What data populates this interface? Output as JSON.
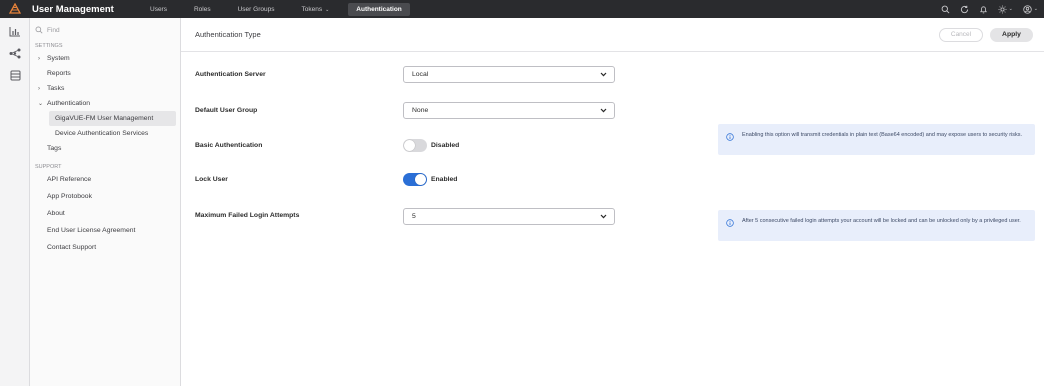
{
  "app": {
    "title": "User Management"
  },
  "nav": {
    "items": [
      {
        "label": "Users"
      },
      {
        "label": "Roles"
      },
      {
        "label": "User Groups"
      },
      {
        "label": "Tokens"
      },
      {
        "label": "Authentication"
      }
    ],
    "active": "Authentication"
  },
  "sidebar": {
    "search_placeholder": "Find",
    "settings_label": "SETTINGS",
    "settings": {
      "system": "System",
      "reports": "Reports",
      "tasks": "Tasks",
      "authentication": "Authentication",
      "auth_children": [
        "GigaVUE-FM User Management",
        "Device Authentication Services"
      ],
      "tags": "Tags"
    },
    "support_label": "SUPPORT",
    "support": [
      "API Reference",
      "App Protobook",
      "About",
      "End User License Agreement",
      "Contact Support"
    ]
  },
  "main": {
    "title": "Authentication Type",
    "cancel_label": "Cancel",
    "apply_label": "Apply",
    "fields": {
      "auth_server": {
        "label": "Authentication Server",
        "value": "Local"
      },
      "default_group": {
        "label": "Default User Group",
        "value": "None"
      },
      "basic_auth": {
        "label": "Basic Authentication",
        "state": "Disabled",
        "enabled": false
      },
      "lock_user": {
        "label": "Lock User",
        "state": "Enabled",
        "enabled": true
      },
      "max_attempts": {
        "label": "Maximum Failed Login Attempts",
        "value": "5"
      }
    },
    "info": {
      "basic_auth": "Enabling this option will transmit credentials in plain text (Base64 encoded) and may expose users to security risks.",
      "lock_user": "After 5 consecutive failed login attempts your account will be locked and can be unlocked only by a privileged user."
    }
  },
  "colors": {
    "topbar": "#2a2b2e",
    "accent": "#2b6fd6",
    "info_bg": "#e8eefb",
    "logo": "#e8833a"
  }
}
